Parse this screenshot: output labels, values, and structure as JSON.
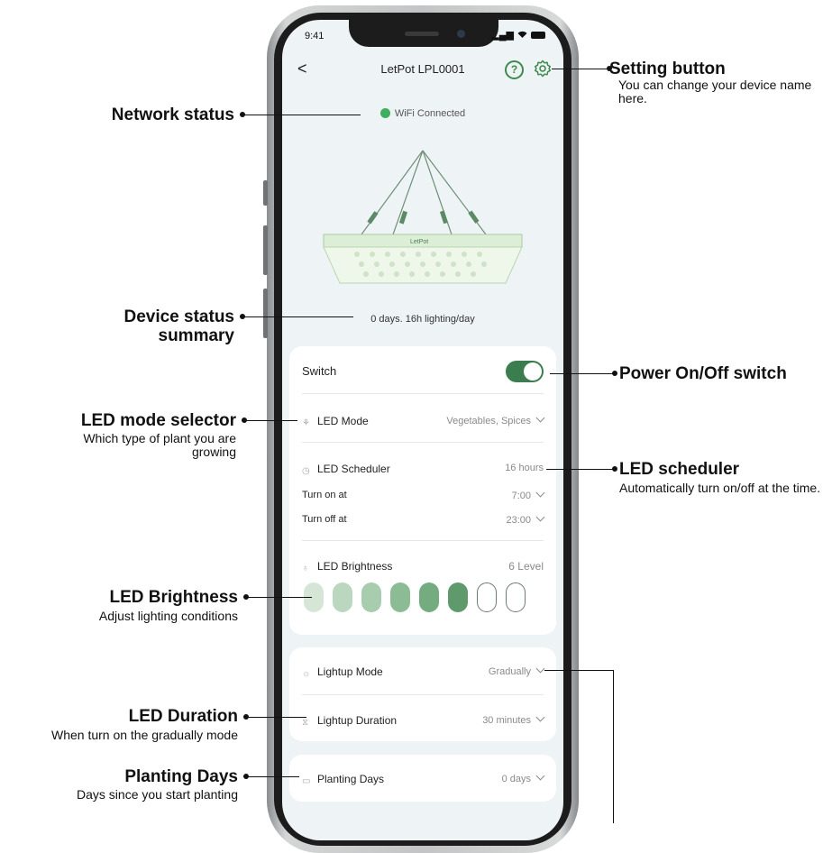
{
  "status_bar": {
    "time": "9:41",
    "signal": "▂▄▆"
  },
  "nav": {
    "back": "<",
    "title": "LetPot LPL0001",
    "help": "?"
  },
  "network": {
    "text": "WiFi Connected"
  },
  "lamp": {
    "brand": "LetPot"
  },
  "summary": {
    "text": "0 days. 16h lighting/day"
  },
  "switch_card": {
    "switch_label": "Switch",
    "switch_on": true,
    "led_mode": {
      "label": "LED Mode",
      "value": "Vegetables, Spices"
    },
    "scheduler": {
      "label": "LED Scheduler",
      "value": "16 hours"
    },
    "turn_on": {
      "label": "Turn on at",
      "value": "7:00"
    },
    "turn_off": {
      "label": "Turn off at",
      "value": "23:00"
    },
    "brightness": {
      "label": "LED Brightness",
      "value": "6 Level",
      "level": 6,
      "max_level": 8
    }
  },
  "lightup_card": {
    "mode": {
      "label": "Lightup Mode",
      "value": "Gradually"
    },
    "duration": {
      "label": "Lightup Duration",
      "value": "30 minutes"
    }
  },
  "planting_card": {
    "label": "Planting Days",
    "value": "0 days"
  },
  "annotations": {
    "setting_title": "Setting button",
    "setting_desc": "You can change your device name here.",
    "network_title": "Network status",
    "device_title": "Device status summary",
    "power_title": "Power On/Off switch",
    "mode_title": "LED mode selector",
    "mode_desc": "Which type of plant you are growing",
    "scheduler_title": "LED scheduler",
    "scheduler_desc": "Automatically turn on/off at the time.",
    "brightness_title": "LED Brightness",
    "brightness_desc": "Adjust lighting conditions",
    "duration_title": "LED Duration",
    "duration_desc": "When turn on the gradually mode",
    "planting_title": "Planting Days",
    "planting_desc": "Days since you start planting"
  },
  "colors": {
    "accent": "#3b7d4f",
    "wifi": "#3fae5d",
    "screen_bg": "#eef3f6"
  }
}
